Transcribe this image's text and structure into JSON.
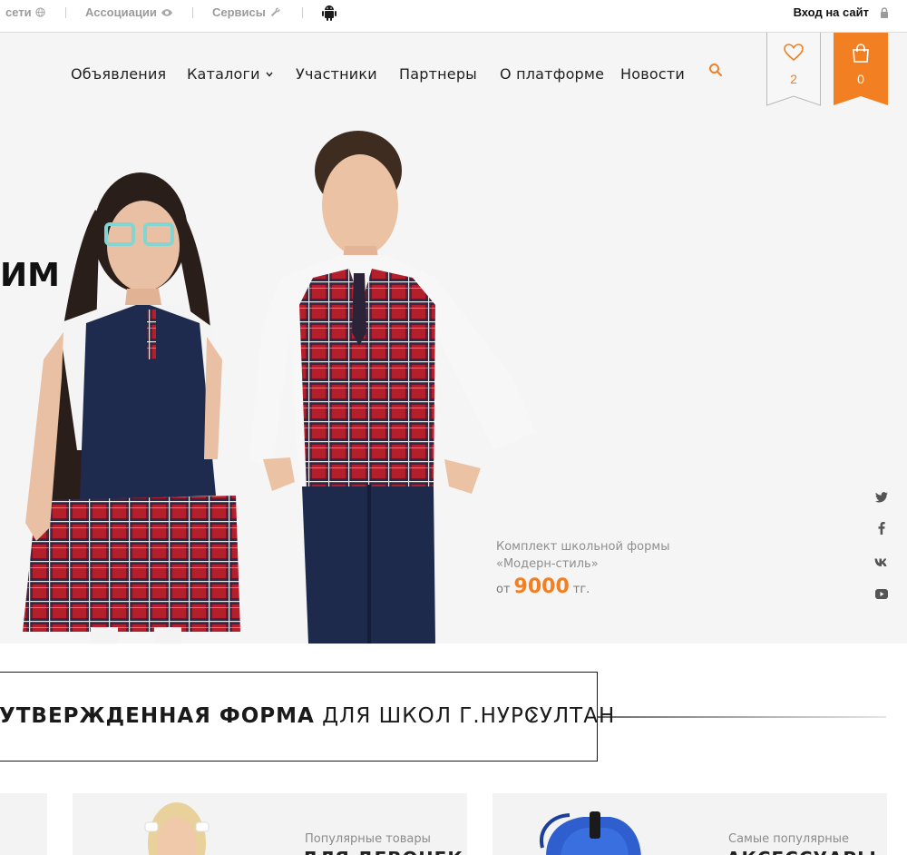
{
  "topbar": {
    "networks_label": "сети",
    "associations_label": "Ассоциации",
    "services_label": "Сервисы",
    "login_label": "Вход на сайт"
  },
  "nav": {
    "items": [
      "Объявления",
      "Каталоги",
      "Участники",
      "Партнеры",
      "О платформе",
      "Новости"
    ],
    "favorites_count": "2",
    "cart_count": "0"
  },
  "hero": {
    "heading": "ИМ",
    "product_caption_line1": "Комплект школьной формы",
    "product_caption_line2": "«Модерн-стиль»",
    "price_prefix": "от",
    "price_value": "9000",
    "price_currency": "тг."
  },
  "banner": {
    "bold_text": "УТВЕРЖДЕННАЯ ФОРМА",
    "regular_text": " ДЛЯ ШКОЛ Г.НУРСУЛТАН"
  },
  "cards": [
    {
      "label": "",
      "title": ""
    },
    {
      "label": "Популярные товары",
      "title": "ДЛЯ ДЕВОЧЕК"
    },
    {
      "label": "Самые популярные",
      "title": "АКСЕССУАРЫ"
    }
  ],
  "colors": {
    "accent": "#f28022",
    "hero_bg": "#f6f5f5",
    "text_dark": "#1f1f1f"
  }
}
